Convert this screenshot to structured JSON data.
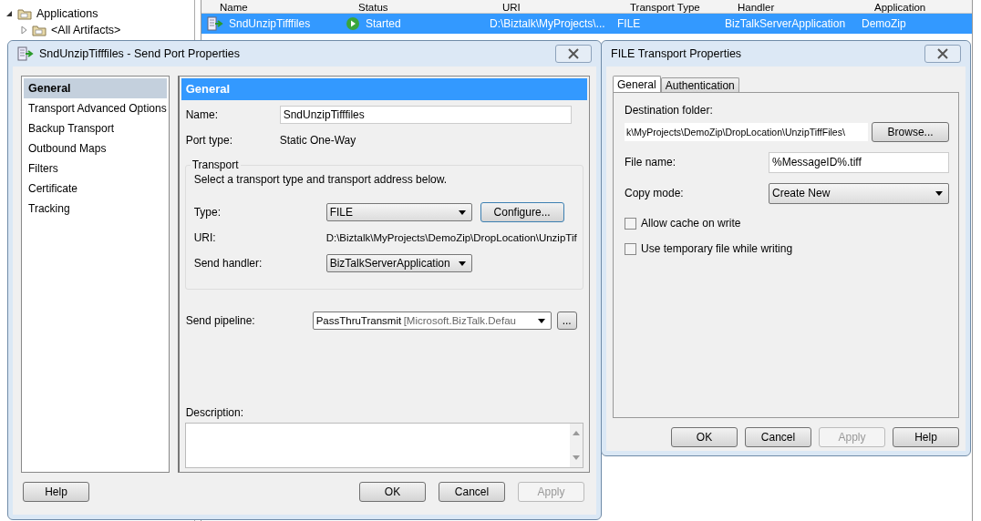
{
  "console": {
    "tree": [
      {
        "label": "Applications",
        "expanded": true,
        "children": [
          {
            "label": "<All Artifacts>",
            "expanded": false
          }
        ]
      }
    ],
    "list": {
      "columns": [
        "Name",
        "Status",
        "URI",
        "Transport Type",
        "Handler",
        "Application"
      ],
      "rows": [
        {
          "selected": true,
          "cells": [
            "SndUnzipTifffiles",
            "Started",
            "D:\\Biztalk\\MyProjects\\...",
            "FILE",
            "BizTalkServerApplication",
            "DemoZip"
          ]
        }
      ]
    }
  },
  "send_port_dialog": {
    "title": "SndUnzipTifffiles - Send Port Properties",
    "nav": [
      {
        "label": "General",
        "selected": true
      },
      {
        "label": "Transport Advanced Options",
        "selected": false
      },
      {
        "label": "Backup Transport",
        "selected": false
      },
      {
        "label": "Outbound Maps",
        "selected": false
      },
      {
        "label": "Filters",
        "selected": false
      },
      {
        "label": "Certificate",
        "selected": false
      },
      {
        "label": "Tracking",
        "selected": false
      }
    ],
    "section_title": "General",
    "name_label": "Name:",
    "name_value": "SndUnzipTifffiles",
    "port_type_label": "Port type:",
    "port_type_value": "Static One-Way",
    "transport": {
      "legend": "Transport",
      "hint": "Select a transport type and transport address below.",
      "type_label": "Type:",
      "type_value": "FILE",
      "configure_button": "Configure...",
      "uri_label": "URI:",
      "uri_value": "D:\\Biztalk\\MyProjects\\DemoZip\\DropLocation\\UnzipTif",
      "handler_label": "Send handler:",
      "handler_value": "BizTalkServerApplication"
    },
    "pipeline_label": "Send pipeline:",
    "pipeline_value": "PassThruTransmit",
    "pipeline_assembly": "[Microsoft.BizTalk.Defau",
    "pipeline_button": "...",
    "description_label": "Description:",
    "buttons": [
      {
        "label": "Help",
        "disabled": false,
        "kind": "left"
      },
      {
        "label": "OK",
        "disabled": false,
        "kind": "right"
      },
      {
        "label": "Cancel",
        "disabled": false,
        "kind": "right"
      },
      {
        "label": "Apply",
        "disabled": true,
        "kind": "right"
      }
    ]
  },
  "file_transport_dialog": {
    "title": "FILE Transport Properties",
    "tabs": [
      {
        "label": "General",
        "selected": true
      },
      {
        "label": "Authentication",
        "selected": false
      }
    ],
    "folder_label": "Destination folder:",
    "folder_value": "k\\MyProjects\\DemoZip\\DropLocation\\UnzipTiffFiles\\",
    "browse_button": "Browse...",
    "file_name_label": "File name:",
    "file_name_value": "%MessageID%.tiff",
    "copy_mode_label": "Copy mode:",
    "copy_mode_value": "Create New",
    "checkboxes": [
      {
        "label": "Allow cache on write",
        "checked": false
      },
      {
        "label": "Use temporary file while writing",
        "checked": false
      }
    ],
    "buttons": [
      {
        "label": "OK",
        "disabled": false
      },
      {
        "label": "Cancel",
        "disabled": false
      },
      {
        "label": "Apply",
        "disabled": true
      },
      {
        "label": "Help",
        "disabled": false
      }
    ]
  }
}
